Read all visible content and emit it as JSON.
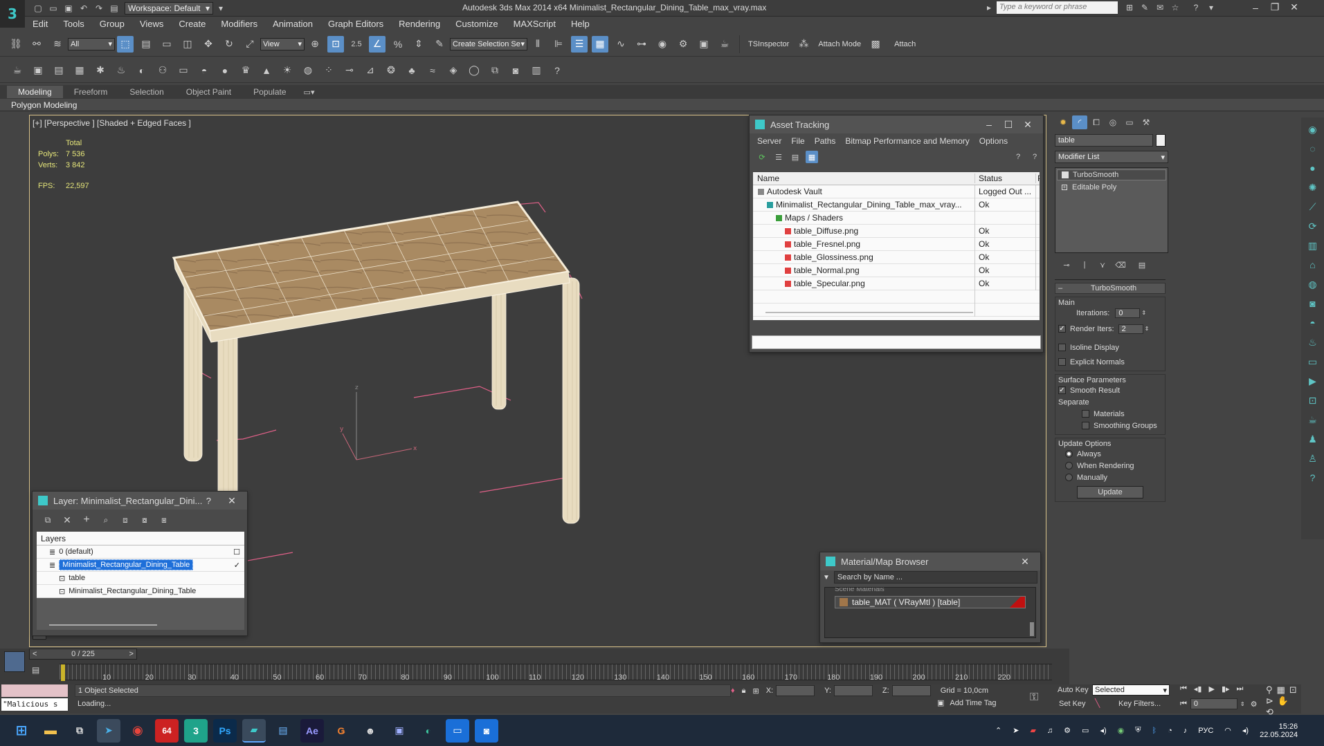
{
  "app": {
    "title": "Autodesk 3ds Max  2014 x64     Minimalist_Rectangular_Dining_Table_max_vray.max",
    "logo": "3",
    "workspace": "Workspace: Default",
    "search_placeholder": "Type a keyword or phrase"
  },
  "menu": [
    "Edit",
    "Tools",
    "Group",
    "Views",
    "Create",
    "Modifiers",
    "Animation",
    "Graph Editors",
    "Rendering",
    "Customize",
    "MAXScript",
    "Help"
  ],
  "toolbar": {
    "filter_value": "All",
    "view_value": "View",
    "snap_value": "2.5",
    "selection_set_value": "Create Selection Se",
    "tsinspector": "TSInspector",
    "attach_mode": "Attach Mode",
    "attach": "Attach"
  },
  "ribbon": {
    "tabs": [
      "Modeling",
      "Freeform",
      "Selection",
      "Object Paint",
      "Populate"
    ],
    "active_tab": "Modeling",
    "sub_label": "Polygon Modeling"
  },
  "viewport": {
    "label": "[+] [Perspective ] [Shaded + Edged Faces ]",
    "stats": {
      "total_label": "Total",
      "polys_label": "Polys:",
      "polys_value": "7 536",
      "verts_label": "Verts:",
      "verts_value": "3 842",
      "fps_label": "FPS:",
      "fps_value": "22,597"
    },
    "axis": {
      "x": "x",
      "y": "y",
      "z": "z"
    }
  },
  "asset_tracking": {
    "title": "Asset Tracking",
    "menu": [
      "Server",
      "File",
      "Paths",
      "Bitmap Performance and Memory",
      "Options"
    ],
    "col_name": "Name",
    "col_status": "Status",
    "col_extra": "P",
    "rows": [
      {
        "name": "Autodesk Vault",
        "status": "Logged Out ...",
        "indent": 0,
        "icon": "vault-icon"
      },
      {
        "name": "Minimalist_Rectangular_Dining_Table_max_vray...",
        "status": "Ok",
        "indent": 1,
        "icon": "max-file-icon"
      },
      {
        "name": "Maps / Shaders",
        "status": "",
        "indent": 2,
        "icon": "maps-folder-icon"
      },
      {
        "name": "table_Diffuse.png",
        "status": "Ok",
        "indent": 3,
        "icon": "png-icon"
      },
      {
        "name": "table_Fresnel.png",
        "status": "Ok",
        "indent": 3,
        "icon": "png-icon"
      },
      {
        "name": "table_Glossiness.png",
        "status": "Ok",
        "indent": 3,
        "icon": "png-icon"
      },
      {
        "name": "table_Normal.png",
        "status": "Ok",
        "indent": 3,
        "icon": "png-icon"
      },
      {
        "name": "table_Specular.png",
        "status": "Ok",
        "indent": 3,
        "icon": "png-icon"
      }
    ]
  },
  "layer_panel": {
    "title": "Layer: Minimalist_Rectangular_Dini...",
    "help": "?",
    "header": "Layers",
    "items": [
      {
        "name": "0 (default)",
        "indent": 1,
        "selected": false
      },
      {
        "name": "Minimalist_Rectangular_Dining_Table",
        "indent": 1,
        "selected": true
      },
      {
        "name": "table",
        "indent": 2,
        "selected": false
      },
      {
        "name": "Minimalist_Rectangular_Dining_Table",
        "indent": 2,
        "selected": false
      }
    ]
  },
  "material_browser": {
    "title": "Material/Map Browser",
    "search_placeholder": "Search by Name ...",
    "section": "Scene Materials",
    "item": "table_MAT  ( VRayMtl )  [table]"
  },
  "command_panel": {
    "name_field": "table",
    "modifier_list": "Modifier List",
    "stack": [
      "TurboSmooth",
      "Editable Poly"
    ],
    "rollout_title": "TurboSmooth",
    "main_label": "Main",
    "iterations_label": "Iterations:",
    "iterations_value": "0",
    "render_iters_label": "Render Iters:",
    "render_iters_value": "2",
    "render_iters_checked": true,
    "isoline_label": "Isoline Display",
    "explicit_label": "Explicit Normals",
    "surface_label": "Surface Parameters",
    "smooth_label": "Smooth Result",
    "separate_label": "Separate",
    "materials_label": "Materials",
    "smoothing_groups_label": "Smoothing Groups",
    "update_options_label": "Update Options",
    "always_label": "Always",
    "when_rendering_label": "When Rendering",
    "manually_label": "Manually",
    "update_button": "Update"
  },
  "timeline": {
    "frame_counter": "0 / 225",
    "ticks": [
      "10",
      "20",
      "30",
      "40",
      "50",
      "60",
      "70",
      "80",
      "90",
      "100",
      "110",
      "120",
      "130",
      "140",
      "150",
      "160",
      "170",
      "180",
      "190",
      "200",
      "210",
      "220"
    ]
  },
  "status": {
    "script_box": "\"Malicious s",
    "selected_text": "1 Object Selected",
    "loading_text": "Loading...",
    "x_label": "X:",
    "y_label": "Y:",
    "z_label": "Z:",
    "grid": "Grid = 10,0cm",
    "add_time_tag": "Add Time Tag",
    "auto_key": "Auto Key",
    "selected_dropdown": "Selected",
    "set_key": "Set Key",
    "key_filters": "Key Filters...",
    "frame_value": "0"
  },
  "taskbar": {
    "apps": [
      "windows-start-icon",
      "file-explorer-icon",
      "task-view-icon",
      "telegram-icon",
      "chrome-icon",
      "app-64-icon",
      "app-3-icon",
      "photoshop-icon",
      "3dsmax-icon",
      "notepad-icon",
      "after-effects-icon",
      "app-g-icon",
      "app-person-icon",
      "save-icon",
      "edge-icon",
      "app-s-icon",
      "camera-icon"
    ],
    "badge_64": "64",
    "badge_3": "3",
    "badge_ps": "Ps",
    "badge_ae": "Ae",
    "lang": "РУС",
    "time": "15:26",
    "date": "22.05.2024"
  },
  "colors": {
    "accent": "#5b8fc7",
    "viewport_border": "#d8c28a",
    "stats_yellow": "#e6e67a",
    "wireframe": "#f5ecd8",
    "tabletop": "#a98a62",
    "bbox_pink": "#e06088",
    "taskbar": "#1e2a3a"
  }
}
